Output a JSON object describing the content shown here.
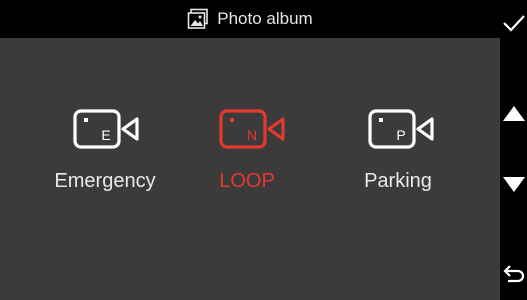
{
  "header": {
    "title": "Photo album",
    "title_icon": "photo-album-icon"
  },
  "sidebar": {
    "confirm_icon": "checkmark-icon",
    "up_icon": "arrow-up-icon",
    "down_icon": "arrow-down-icon",
    "back_icon": "return-icon"
  },
  "modes": [
    {
      "label": "Emergency",
      "letter": "E",
      "icon": "video-camera-icon",
      "selected": false
    },
    {
      "label": "LOOP",
      "letter": "N",
      "icon": "video-camera-icon",
      "selected": true
    },
    {
      "label": "Parking",
      "letter": "P",
      "icon": "video-camera-icon",
      "selected": false
    }
  ],
  "colors": {
    "background": "#3b3b3b",
    "bar": "#000000",
    "text": "#e9e9e9",
    "accent": "#e23a2c"
  }
}
